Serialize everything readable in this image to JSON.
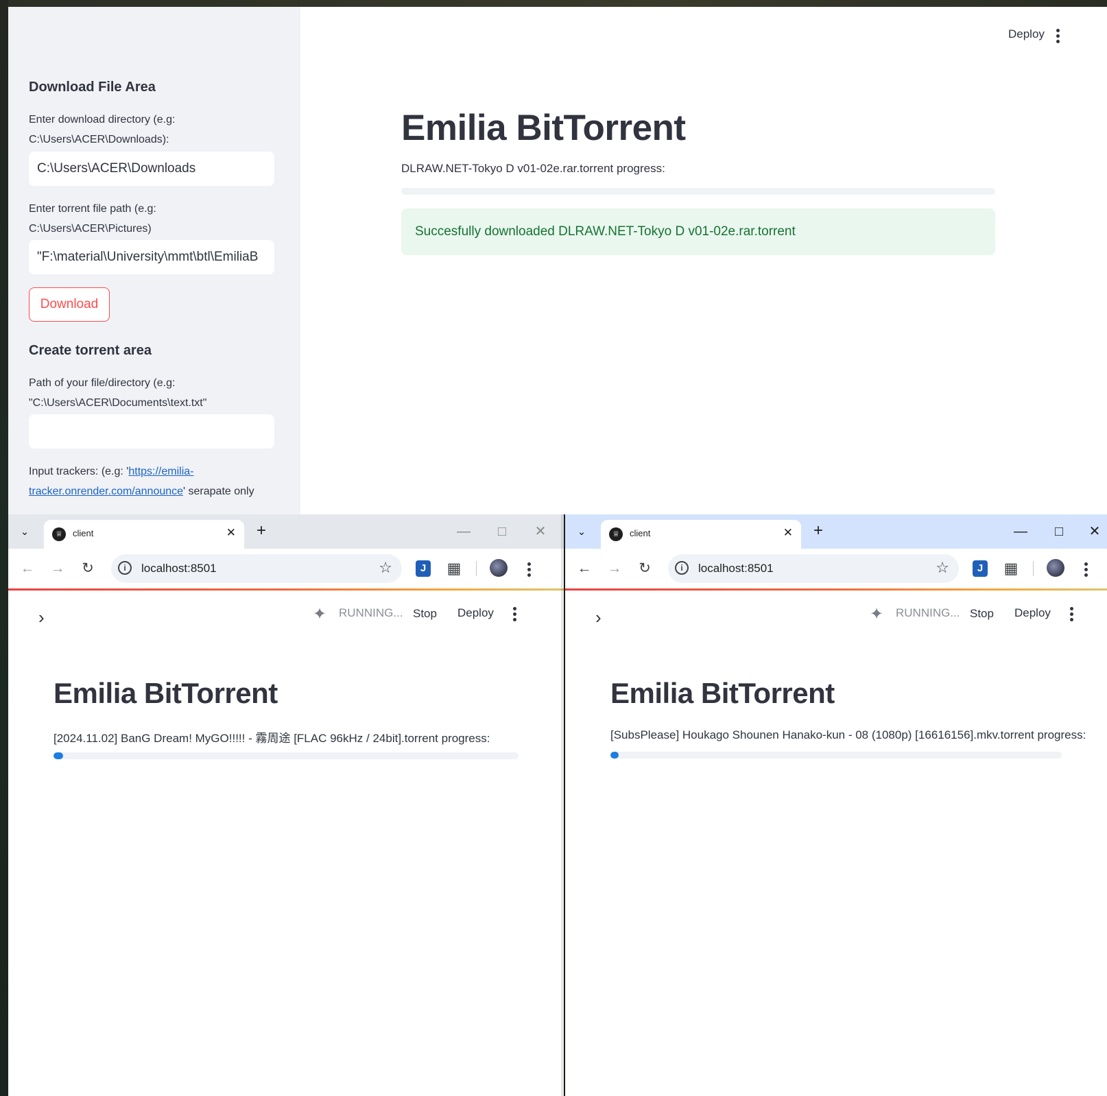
{
  "main_window": {
    "sidebar": {
      "download_heading": "Download File Area",
      "download_dir_label": "Enter download directory (e.g: C:\\Users\\ACER\\Downloads):",
      "download_dir_value": "C:\\Users\\ACER\\Downloads",
      "torrent_path_label": "Enter torrent file path (e.g: C:\\Users\\ACER\\Pictures)",
      "torrent_path_value": "\"F:\\material\\University\\mmt\\btl\\EmiliaB",
      "download_button": "Download",
      "create_heading": "Create torrent area",
      "file_path_label": "Path of your file/directory (e.g: \"C:\\Users\\ACER\\Documents\\text.txt\"",
      "file_path_value": "",
      "trackers_label_prefix": "Input trackers: (e.g: '",
      "trackers_link": "https://emilia-tracker.onrender.com/announce",
      "trackers_label_suffix": "' serapate only"
    },
    "header": {
      "deploy": "Deploy"
    },
    "title": "Emilia BitTorrent",
    "progress_label": "DLRAW.NET-Tokyo D v01-02e.rar.torrent progress:",
    "progress_fraction": 0.0,
    "success_message": "Succesfully downloaded DLRAW.NET-Tokyo D v01-02e.rar.torrent"
  },
  "browsers": [
    {
      "tab_title": "client",
      "url": "localhost:8501",
      "status": "RUNNING...",
      "stop": "Stop",
      "deploy": "Deploy",
      "title": "Emilia BitTorrent",
      "progress_label": "[2024.11.02] BanG Dream! MyGO!!!!! - 霧周途 [FLAC 96kHz / 24bit].torrent progress:",
      "progress_fraction": 0.02
    },
    {
      "tab_title": "client",
      "url": "localhost:8501",
      "status": "RUNNING...",
      "stop": "Stop",
      "deploy": "Deploy",
      "title": "Emilia BitTorrent",
      "progress_label": "[SubsPlease] Houkago Shounen Hanako-kun - 08 (1080p) [16616156].mkv.torrent progress:",
      "progress_fraction": 0.01
    }
  ],
  "colors": {
    "accent_red": "#ff4b4b",
    "progress_blue": "#1e7de0",
    "success_bg": "#e9f7ee",
    "success_text": "#177233",
    "sidebar_bg": "#f0f2f6",
    "link": "#1c63c4"
  },
  "icons": {
    "kebab": "kebab-menu-icon",
    "running": "running-person-icon",
    "chevron": "chevron-right-icon",
    "back": "arrow-left-icon",
    "forward": "arrow-right-icon",
    "reload": "reload-icon",
    "star": "bookmark-star-icon",
    "extensions": "puzzle-icon",
    "profile": "avatar"
  }
}
